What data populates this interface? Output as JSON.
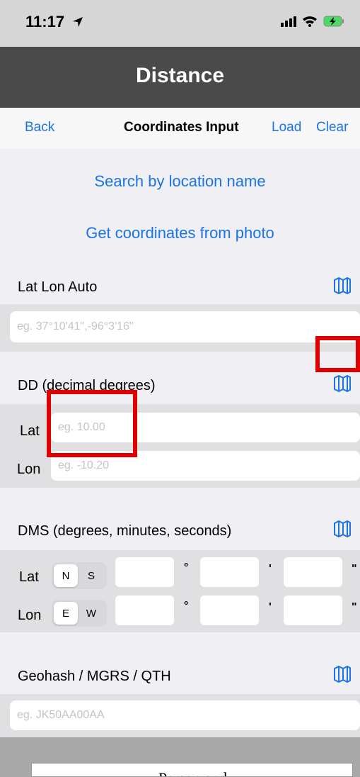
{
  "status": {
    "time": "11:17"
  },
  "title": "Distance",
  "nav": {
    "back": "Back",
    "title": "Coordinates Input",
    "load": "Load",
    "clear": "Clear"
  },
  "links": {
    "search": "Search by location name",
    "photo": "Get coordinates from photo"
  },
  "sections": {
    "latlon_auto": {
      "label": "Lat Lon Auto",
      "placeholder": "eg. 37°10'41\",-96°3'16\""
    },
    "dd": {
      "label": "DD (decimal degrees)",
      "lat_label": "Lat",
      "lat_placeholder": "eg. 10.00",
      "lon_label": "Lon",
      "lon_placeholder": "eg. -10.20"
    },
    "dms": {
      "label": "DMS (degrees, minutes, seconds)",
      "lat_label": "Lat",
      "lat_seg": [
        "N",
        "S"
      ],
      "lon_label": "Lon",
      "lon_seg": [
        "E",
        "W"
      ],
      "degree_symbol": "°",
      "minute_symbol": "'",
      "second_symbol": "\""
    },
    "geohash": {
      "label": "Geohash / MGRS / QTH",
      "placeholder": "eg. JK50AA00AA"
    }
  },
  "bottom_panel": {
    "text": "Person and"
  },
  "colors": {
    "accent": "#1a73e8",
    "title_bar": "#4a4a4a",
    "highlight": "#e00000"
  },
  "icons": [
    "location-arrow-icon",
    "signal-icon",
    "wifi-icon",
    "battery-charging-icon",
    "map-icon"
  ]
}
